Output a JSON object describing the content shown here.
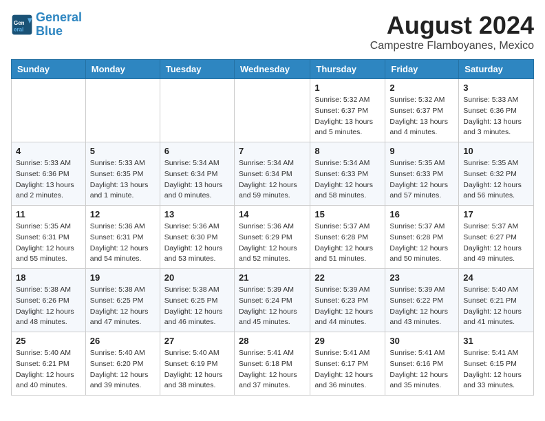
{
  "header": {
    "logo_line1": "General",
    "logo_line2": "Blue",
    "title": "August 2024",
    "subtitle": "Campestre Flamboyanes, Mexico"
  },
  "days_of_week": [
    "Sunday",
    "Monday",
    "Tuesday",
    "Wednesday",
    "Thursday",
    "Friday",
    "Saturday"
  ],
  "weeks": [
    [
      {
        "day": "",
        "info": ""
      },
      {
        "day": "",
        "info": ""
      },
      {
        "day": "",
        "info": ""
      },
      {
        "day": "",
        "info": ""
      },
      {
        "day": "1",
        "info": "Sunrise: 5:32 AM\nSunset: 6:37 PM\nDaylight: 13 hours\nand 5 minutes."
      },
      {
        "day": "2",
        "info": "Sunrise: 5:32 AM\nSunset: 6:37 PM\nDaylight: 13 hours\nand 4 minutes."
      },
      {
        "day": "3",
        "info": "Sunrise: 5:33 AM\nSunset: 6:36 PM\nDaylight: 13 hours\nand 3 minutes."
      }
    ],
    [
      {
        "day": "4",
        "info": "Sunrise: 5:33 AM\nSunset: 6:36 PM\nDaylight: 13 hours\nand 2 minutes."
      },
      {
        "day": "5",
        "info": "Sunrise: 5:33 AM\nSunset: 6:35 PM\nDaylight: 13 hours\nand 1 minute."
      },
      {
        "day": "6",
        "info": "Sunrise: 5:34 AM\nSunset: 6:34 PM\nDaylight: 13 hours\nand 0 minutes."
      },
      {
        "day": "7",
        "info": "Sunrise: 5:34 AM\nSunset: 6:34 PM\nDaylight: 12 hours\nand 59 minutes."
      },
      {
        "day": "8",
        "info": "Sunrise: 5:34 AM\nSunset: 6:33 PM\nDaylight: 12 hours\nand 58 minutes."
      },
      {
        "day": "9",
        "info": "Sunrise: 5:35 AM\nSunset: 6:33 PM\nDaylight: 12 hours\nand 57 minutes."
      },
      {
        "day": "10",
        "info": "Sunrise: 5:35 AM\nSunset: 6:32 PM\nDaylight: 12 hours\nand 56 minutes."
      }
    ],
    [
      {
        "day": "11",
        "info": "Sunrise: 5:35 AM\nSunset: 6:31 PM\nDaylight: 12 hours\nand 55 minutes."
      },
      {
        "day": "12",
        "info": "Sunrise: 5:36 AM\nSunset: 6:31 PM\nDaylight: 12 hours\nand 54 minutes."
      },
      {
        "day": "13",
        "info": "Sunrise: 5:36 AM\nSunset: 6:30 PM\nDaylight: 12 hours\nand 53 minutes."
      },
      {
        "day": "14",
        "info": "Sunrise: 5:36 AM\nSunset: 6:29 PM\nDaylight: 12 hours\nand 52 minutes."
      },
      {
        "day": "15",
        "info": "Sunrise: 5:37 AM\nSunset: 6:28 PM\nDaylight: 12 hours\nand 51 minutes."
      },
      {
        "day": "16",
        "info": "Sunrise: 5:37 AM\nSunset: 6:28 PM\nDaylight: 12 hours\nand 50 minutes."
      },
      {
        "day": "17",
        "info": "Sunrise: 5:37 AM\nSunset: 6:27 PM\nDaylight: 12 hours\nand 49 minutes."
      }
    ],
    [
      {
        "day": "18",
        "info": "Sunrise: 5:38 AM\nSunset: 6:26 PM\nDaylight: 12 hours\nand 48 minutes."
      },
      {
        "day": "19",
        "info": "Sunrise: 5:38 AM\nSunset: 6:25 PM\nDaylight: 12 hours\nand 47 minutes."
      },
      {
        "day": "20",
        "info": "Sunrise: 5:38 AM\nSunset: 6:25 PM\nDaylight: 12 hours\nand 46 minutes."
      },
      {
        "day": "21",
        "info": "Sunrise: 5:39 AM\nSunset: 6:24 PM\nDaylight: 12 hours\nand 45 minutes."
      },
      {
        "day": "22",
        "info": "Sunrise: 5:39 AM\nSunset: 6:23 PM\nDaylight: 12 hours\nand 44 minutes."
      },
      {
        "day": "23",
        "info": "Sunrise: 5:39 AM\nSunset: 6:22 PM\nDaylight: 12 hours\nand 43 minutes."
      },
      {
        "day": "24",
        "info": "Sunrise: 5:40 AM\nSunset: 6:21 PM\nDaylight: 12 hours\nand 41 minutes."
      }
    ],
    [
      {
        "day": "25",
        "info": "Sunrise: 5:40 AM\nSunset: 6:21 PM\nDaylight: 12 hours\nand 40 minutes."
      },
      {
        "day": "26",
        "info": "Sunrise: 5:40 AM\nSunset: 6:20 PM\nDaylight: 12 hours\nand 39 minutes."
      },
      {
        "day": "27",
        "info": "Sunrise: 5:40 AM\nSunset: 6:19 PM\nDaylight: 12 hours\nand 38 minutes."
      },
      {
        "day": "28",
        "info": "Sunrise: 5:41 AM\nSunset: 6:18 PM\nDaylight: 12 hours\nand 37 minutes."
      },
      {
        "day": "29",
        "info": "Sunrise: 5:41 AM\nSunset: 6:17 PM\nDaylight: 12 hours\nand 36 minutes."
      },
      {
        "day": "30",
        "info": "Sunrise: 5:41 AM\nSunset: 6:16 PM\nDaylight: 12 hours\nand 35 minutes."
      },
      {
        "day": "31",
        "info": "Sunrise: 5:41 AM\nSunset: 6:15 PM\nDaylight: 12 hours\nand 33 minutes."
      }
    ]
  ]
}
